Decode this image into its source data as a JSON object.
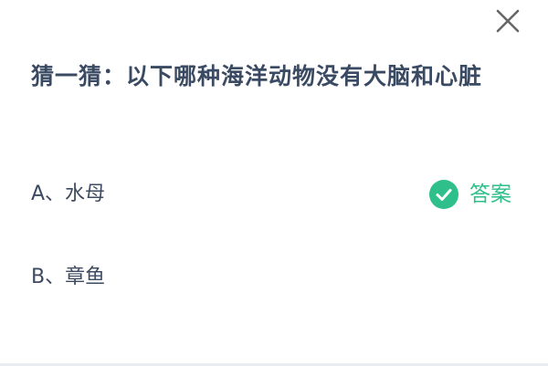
{
  "dialog": {
    "question": "猜一猜：以下哪种海洋动物没有大脑和心脏",
    "options": [
      {
        "label": "A、水母",
        "is_answer": true
      },
      {
        "label": "B、章鱼",
        "is_answer": false
      }
    ],
    "answer_label": "答案",
    "icons": {
      "close": "close-icon",
      "check": "check-circle-icon"
    },
    "colors": {
      "question_text": "#3b4a63",
      "option_text": "#3d4a60",
      "answer_accent": "#2fbf8a",
      "close_icon": "#666666"
    }
  }
}
